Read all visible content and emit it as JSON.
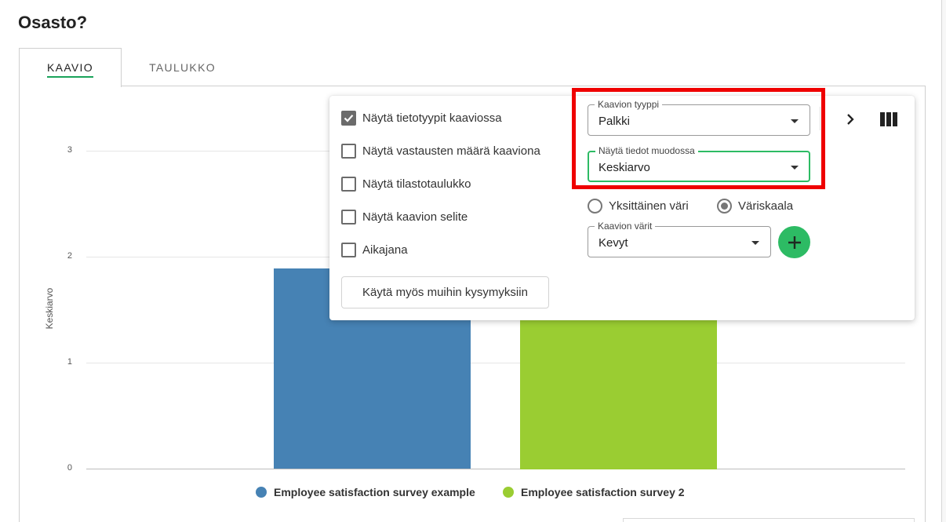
{
  "page": {
    "title": "Osasto?"
  },
  "tabs": [
    {
      "label": "KAAVIO",
      "active": true
    },
    {
      "label": "TAULUKKO",
      "active": false
    }
  ],
  "chart_data": {
    "type": "bar",
    "ylabel": "Keskiarvo",
    "xlabel": "",
    "ylim": [
      0,
      3
    ],
    "yticks": [
      "0",
      "1",
      "2",
      "3"
    ],
    "grid": true,
    "legend_placement": "bottom",
    "series": [
      {
        "name": "Employee satisfaction survey example",
        "value": 1.89,
        "color": "#4682b4"
      },
      {
        "name": "Employee satisfaction survey 2",
        "value": 1.5,
        "color": "#9acd32"
      }
    ]
  },
  "options_popup": {
    "checkboxes": [
      {
        "label": "Näytä tietotyypit kaaviossa",
        "checked": true
      },
      {
        "label": "Näytä vastausten määrä kaaviona",
        "checked": false
      },
      {
        "label": "Näytä tilastotaulukko",
        "checked": false
      },
      {
        "label": "Näytä kaavion selite",
        "checked": false
      },
      {
        "label": "Aikajana",
        "checked": false
      }
    ],
    "apply_button": "Käytä myös muihin kysymyksiin",
    "chart_type": {
      "label": "Kaavion tyyppi",
      "value": "Palkki"
    },
    "display_as": {
      "label": "Näytä tiedot muodossa",
      "value": "Keskiarvo"
    },
    "color_mode": {
      "options": [
        {
          "label": "Yksittäinen väri",
          "selected": false
        },
        {
          "label": "Väriskaala",
          "selected": true
        }
      ]
    },
    "chart_colors": {
      "label": "Kaavion värit",
      "value": "Kevyt"
    }
  },
  "icons": {
    "next": "chevron-right-icon",
    "columns": "columns-icon",
    "add": "plus-icon",
    "check": "check-icon"
  },
  "colors": {
    "accent_green": "#2dbb64",
    "highlight_red": "#ef0000",
    "series_blue": "#4682b4",
    "series_green": "#9acd32"
  }
}
